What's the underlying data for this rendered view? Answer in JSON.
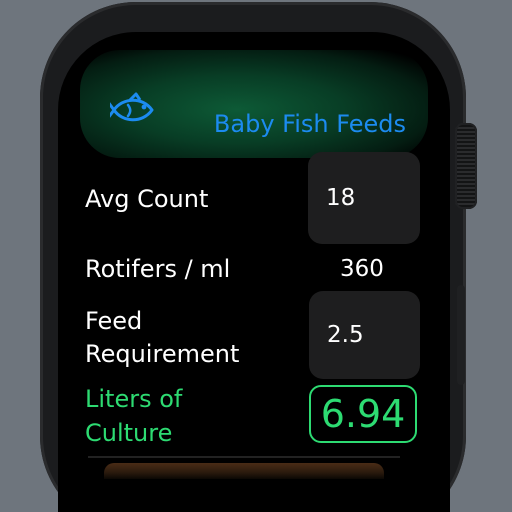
{
  "app": {
    "title": "Baby Fish Feeds",
    "icon": "fish-icon",
    "accent_color": "#1c8bf0",
    "result_color": "#2ddb72"
  },
  "form": {
    "avg_count": {
      "label": "Avg Count",
      "value": "18"
    },
    "rotifers": {
      "label": "Rotifers / ml",
      "value": "360"
    },
    "feed_requirement": {
      "label_line1": "Feed",
      "label_line2": "Requirement",
      "value": "2.5"
    },
    "liters_of_culture": {
      "label_line1": "Liters of",
      "label_line2": "Culture",
      "value": "6.94"
    }
  }
}
